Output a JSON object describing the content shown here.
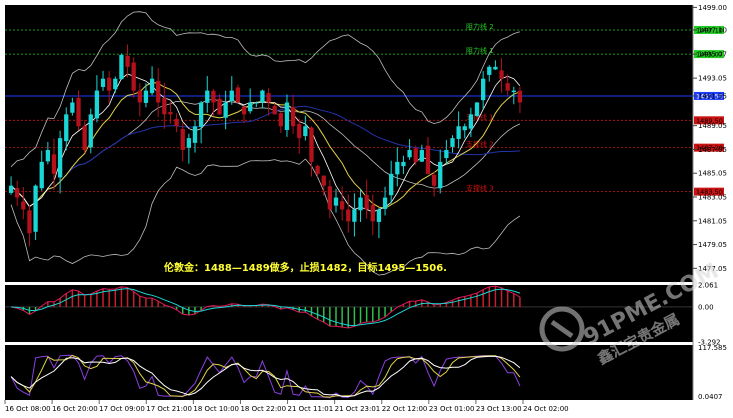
{
  "chart_data": {
    "type": "candlestick",
    "panels": [
      {
        "name": "price",
        "ylim": [
          1475.9,
          1499.2
        ],
        "bollinger": true,
        "moving_averages": true
      },
      {
        "name": "macd",
        "ylim": [
          -3.292,
          2.061
        ]
      },
      {
        "name": "stochastic",
        "ylim": [
          0,
          117.585
        ]
      }
    ],
    "price_ticks": [
      "1499.00",
      "1497.10",
      "1495.07",
      "1493.05",
      "1491.55",
      "1489.05",
      "1487.05",
      "1485.05",
      "1483.05",
      "1481.05",
      "1479.05",
      "1477.05"
    ],
    "macd_ticks": [
      "2.061",
      "0.00",
      "-3.292"
    ],
    "stoch_ticks": [
      "117.585",
      "0.0407"
    ],
    "x_labels": [
      "16 Oct 08:00",
      "16 Oct 20:00",
      "17 Oct 09:00",
      "17 Oct 21:00",
      "18 Oct 10:00",
      "18 Oct 22:00",
      "21 Oct 11:01",
      "21 Oct 23:01",
      "22 Oct 12:00",
      "23 Oct 01:00",
      "23 Oct 13:00",
      "24 Oct 02:00"
    ],
    "levels": [
      {
        "label": "阻力线 2",
        "price": 1497.1,
        "tag": "1497.10",
        "color": "#22cc22"
      },
      {
        "label": "阻力线 1",
        "price": 1495.07,
        "tag": "1495.07",
        "color": "#22cc22"
      },
      {
        "label": "支撑线 1",
        "price": 1489.5,
        "tag": "1489.50",
        "color": "#cc1111"
      },
      {
        "label": "支撑线 2",
        "price": 1487.2,
        "tag": "1487.20",
        "color": "#cc1111"
      },
      {
        "label": "支撑线 3",
        "price": 1483.5,
        "tag": "1483.50",
        "color": "#cc1111"
      }
    ],
    "current_price": {
      "price": 1491.55,
      "tag": "1491.55"
    },
    "closes": [
      1484,
      1483,
      1482,
      1480,
      1484,
      1486,
      1487,
      1485,
      1488,
      1490,
      1491,
      1489,
      1487,
      1490,
      1492,
      1493,
      1492,
      1493,
      1495,
      1494,
      1492,
      1491,
      1492,
      1493,
      1491,
      1490,
      1490,
      1489,
      1487,
      1488,
      1489,
      1491,
      1492,
      1491,
      1490,
      1491,
      1492,
      1491,
      1490,
      1491,
      1491,
      1492,
      1491,
      1490,
      1489,
      1491,
      1489,
      1488,
      1489,
      1486,
      1485,
      1484,
      1482,
      1483,
      1482,
      1481,
      1482,
      1483,
      1482,
      1481,
      1482,
      1483,
      1485,
      1486,
      1486,
      1487,
      1486,
      1487,
      1485,
      1484,
      1486,
      1487,
      1488,
      1489,
      1489,
      1490,
      1491,
      1493,
      1494,
      1494,
      1493,
      1492,
      1492,
      1491
    ],
    "annotation": "伦敦金：1488—1489做多，止损1482，目标1495—1506."
  },
  "watermark": {
    "brand": "91PME.COM",
    "sub": "鑫汇宝贵金属"
  }
}
